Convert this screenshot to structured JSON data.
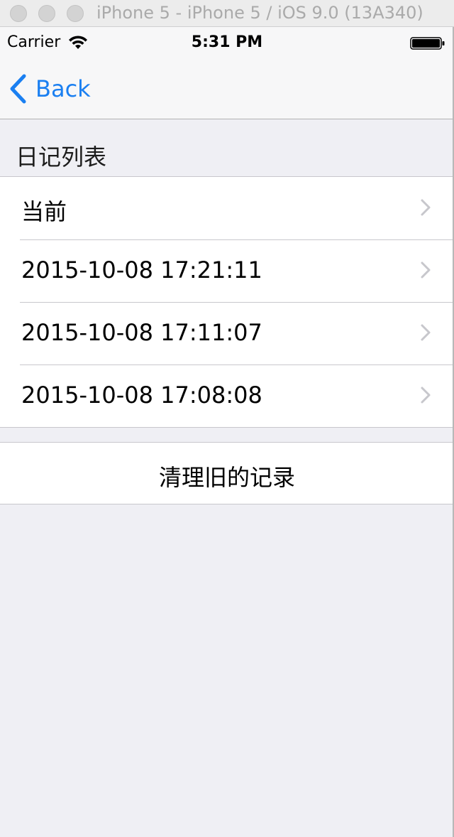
{
  "window": {
    "title": "iPhone 5 - iPhone 5 / iOS 9.0 (13A340)"
  },
  "status_bar": {
    "carrier": "Carrier",
    "time": "5:31 PM",
    "icons": [
      "wifi-icon",
      "battery-icon"
    ]
  },
  "nav_bar": {
    "back_label": "Back",
    "back_icon": "chevron-left-icon",
    "accent_color": "#1a7ff1"
  },
  "diary_section": {
    "header": "日记列表",
    "items": [
      {
        "label": "当前"
      },
      {
        "label": "2015-10-08 17:21:11"
      },
      {
        "label": "2015-10-08 17:11:07"
      },
      {
        "label": "2015-10-08 17:08:08"
      }
    ],
    "disclosure_icon": "chevron-right-icon"
  },
  "actions": {
    "clear_old_label": "清理旧的记录"
  }
}
